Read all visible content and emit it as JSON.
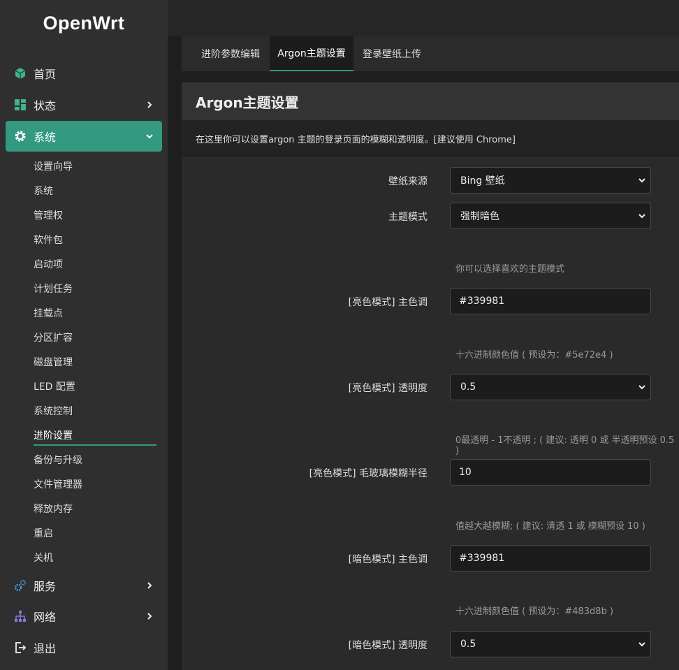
{
  "brand": "OpenWrt",
  "nav": {
    "home": "首页",
    "status": "状态",
    "system": "系统",
    "services": "服务",
    "network": "网络",
    "logout": "退出"
  },
  "system_submenu": [
    "设置向导",
    "系统",
    "管理权",
    "软件包",
    "启动项",
    "计划任务",
    "挂载点",
    "分区扩容",
    "磁盘管理",
    "LED 配置",
    "系统控制",
    "进阶设置",
    "备份与升级",
    "文件管理器",
    "释放内存",
    "重启",
    "关机"
  ],
  "tabs": [
    "进阶参数编辑",
    "Argon主题设置",
    "登录壁纸上传"
  ],
  "section": {
    "title": "Argon主题设置",
    "description": "在这里你可以设置argon 主题的登录页面的模糊和透明度。[建议使用 Chrome]"
  },
  "form": {
    "wallpaper_source": {
      "label": "壁纸来源",
      "value": "Bing 壁纸"
    },
    "theme_mode": {
      "label": "主题模式",
      "value": "强制暗色",
      "hint": "你可以选择喜欢的主题模式"
    },
    "light_primary": {
      "label": "[亮色模式] 主色调",
      "value": "#339981",
      "hint": "十六进制颜色值 ( 预设为：#5e72e4 )"
    },
    "light_transparency": {
      "label": "[亮色模式] 透明度",
      "value": "0.5",
      "hint": "0最透明 - 1不透明 ; ( 建议: 透明 0 或 半透明预设 0.5 )"
    },
    "light_blur": {
      "label": "[亮色模式] 毛玻璃模糊半径",
      "value": "10",
      "hint": "值越大越模糊; ( 建议: 清透 1 或 模糊预设 10 )"
    },
    "dark_primary": {
      "label": "[暗色模式] 主色调",
      "value": "#339981",
      "hint": "十六进制颜色值 ( 预设为：#483d8b )"
    },
    "dark_transparency": {
      "label": "[暗色模式] 透明度",
      "value": "0.5"
    }
  },
  "colors": {
    "accent": "#339981",
    "background": "#1e1e1e",
    "sidebar": "#2f2f2f"
  }
}
